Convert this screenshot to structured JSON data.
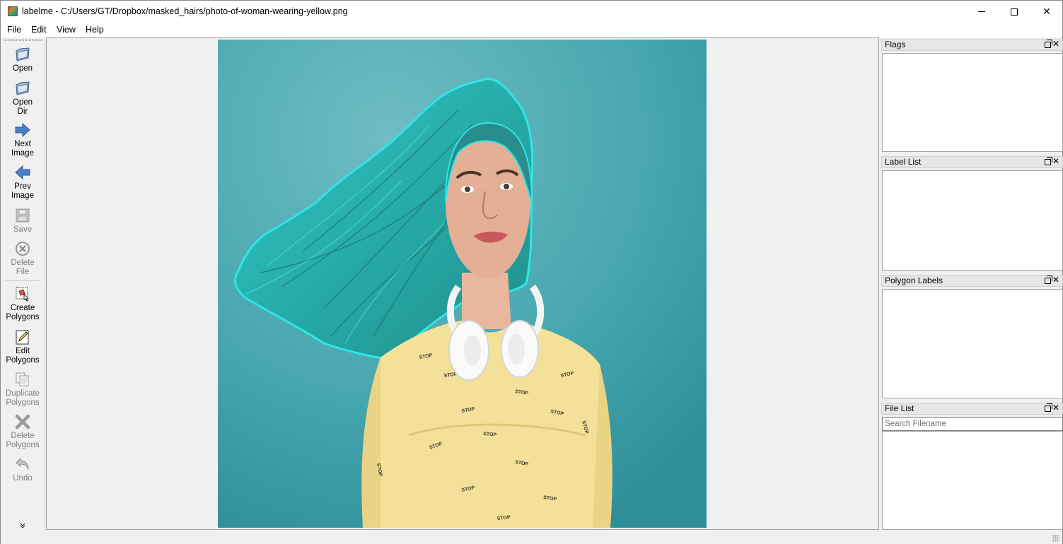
{
  "window": {
    "title": "labelme - C:/Users/GT/Dropbox/masked_hairs/photo-of-woman-wearing-yellow.png",
    "minimize_glyph": "",
    "maximize_glyph": "",
    "close_glyph": "✕"
  },
  "menu": {
    "file": "File",
    "edit": "Edit",
    "view": "View",
    "help": "Help"
  },
  "toolbar": {
    "open": "Open",
    "open_dir_1": "Open",
    "open_dir_2": "Dir",
    "next_1": "Next",
    "next_2": "Image",
    "prev_1": "Prev",
    "prev_2": "Image",
    "save": "Save",
    "delete_file_1": "Delete",
    "delete_file_2": "File",
    "create_1": "Create",
    "create_2": "Polygons",
    "edit_1": "Edit",
    "edit_2": "Polygons",
    "duplicate_1": "Duplicate",
    "duplicate_2": "Polygons",
    "delete_poly_1": "Delete",
    "delete_poly_2": "Polygons",
    "undo": "Undo",
    "more": "»"
  },
  "docks": {
    "flags": "Flags",
    "label_list": "Label List",
    "polygon_labels": "Polygon Labels",
    "file_list": "File List",
    "search_placeholder": "Search Filename"
  },
  "image": {
    "shirt_text": "STOP",
    "mask_color": "#2ee6e6",
    "background_color": "#3fa3aa"
  }
}
